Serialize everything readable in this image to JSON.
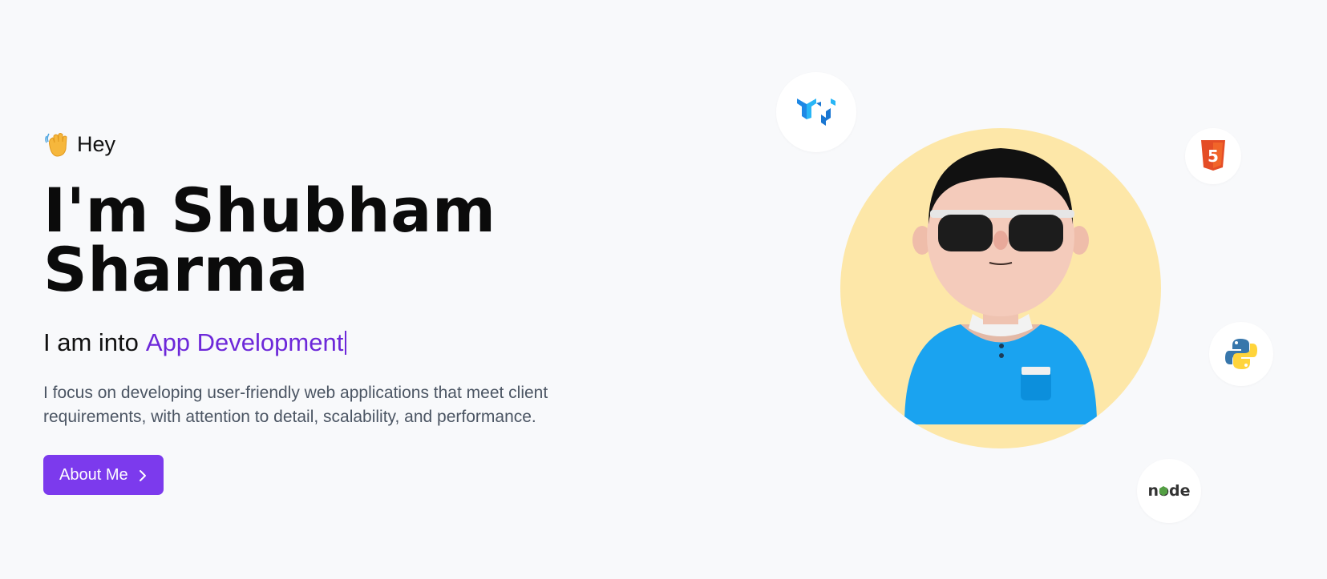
{
  "hero": {
    "greeting": "Hey",
    "name_line1": "I'm Shubham",
    "name_line2": "Sharma",
    "tagline_prefix": "I am into",
    "tagline_highlight": "App Development",
    "description": "I focus on developing user-friendly web applications that meet client requirements, with attention to detail, scalability, and performance.",
    "cta_label": "About Me"
  },
  "icons": {
    "greeting": "waving-hand-icon",
    "cta": "chevron-right-icon",
    "tech": [
      "material-ui-logo",
      "html5-logo",
      "python-logo",
      "nodejs-logo"
    ]
  },
  "tech_badges": {
    "node_text": "node",
    "html_text": "5"
  },
  "colors": {
    "accent": "#6d28d9",
    "button": "#7c3aed",
    "avatar_bg": "#fde7a8",
    "page_bg": "#f8f9fb"
  }
}
